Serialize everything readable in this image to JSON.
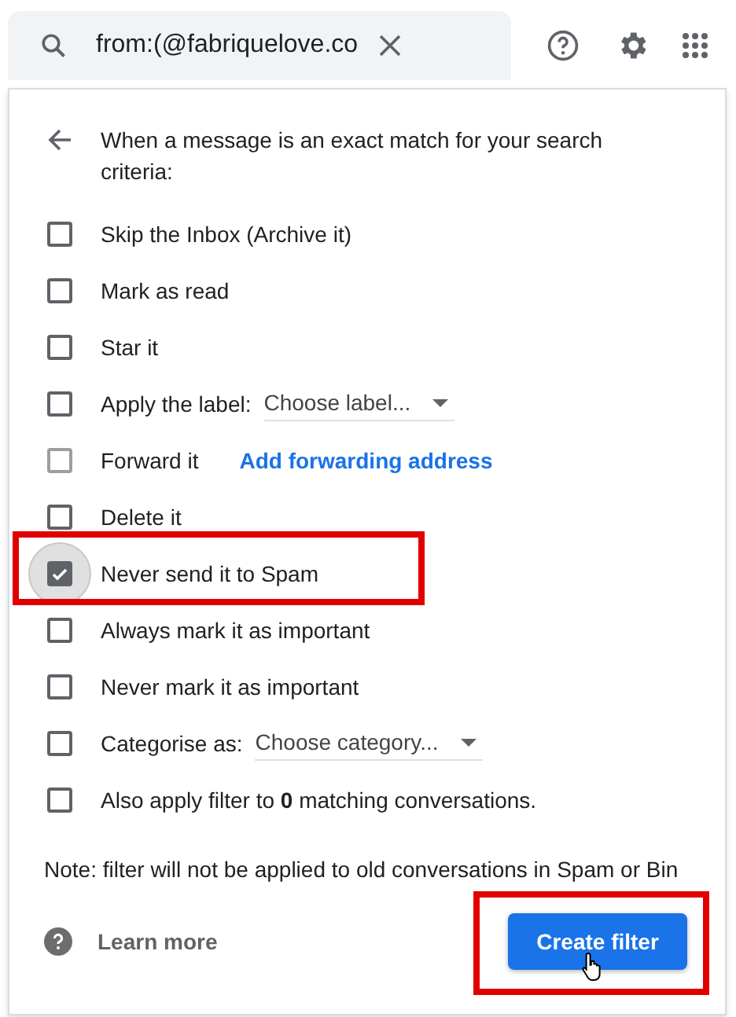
{
  "search": {
    "value": "from:(@fabriquelove.co"
  },
  "panel": {
    "heading": "When a message is an exact match for your search criteria:",
    "options": [
      {
        "kind": "plain",
        "label": "Skip the Inbox (Archive it)",
        "checked": false,
        "disabled": false,
        "highlighted": false
      },
      {
        "kind": "plain",
        "label": "Mark as read",
        "checked": false,
        "disabled": false,
        "highlighted": false
      },
      {
        "kind": "plain",
        "label": "Star it",
        "checked": false,
        "disabled": false,
        "highlighted": false
      },
      {
        "kind": "select",
        "label": "Apply the label:",
        "select": "Choose label...",
        "checked": false,
        "disabled": false,
        "highlighted": false
      },
      {
        "kind": "link",
        "label": "Forward it",
        "link": "Add forwarding address",
        "checked": false,
        "disabled": true,
        "highlighted": false
      },
      {
        "kind": "plain",
        "label": "Delete it",
        "checked": false,
        "disabled": false,
        "highlighted": false
      },
      {
        "kind": "plain",
        "label": "Never send it to Spam",
        "checked": true,
        "disabled": false,
        "highlighted": true
      },
      {
        "kind": "plain",
        "label": "Always mark it as important",
        "checked": false,
        "disabled": false,
        "highlighted": false
      },
      {
        "kind": "plain",
        "label": "Never mark it as important",
        "checked": false,
        "disabled": false,
        "highlighted": false
      },
      {
        "kind": "select",
        "label": "Categorise as:",
        "select": "Choose category...",
        "checked": false,
        "disabled": false,
        "highlighted": false
      },
      {
        "kind": "rich",
        "label": "Also apply filter to **0** matching conversations.",
        "checked": false,
        "disabled": false,
        "highlighted": false
      }
    ],
    "note": "Note: filter will not be applied to old conversations in Spam or Bin",
    "learn_more": "Learn more",
    "create_button": {
      "label": "Create filter",
      "highlighted": true
    }
  }
}
